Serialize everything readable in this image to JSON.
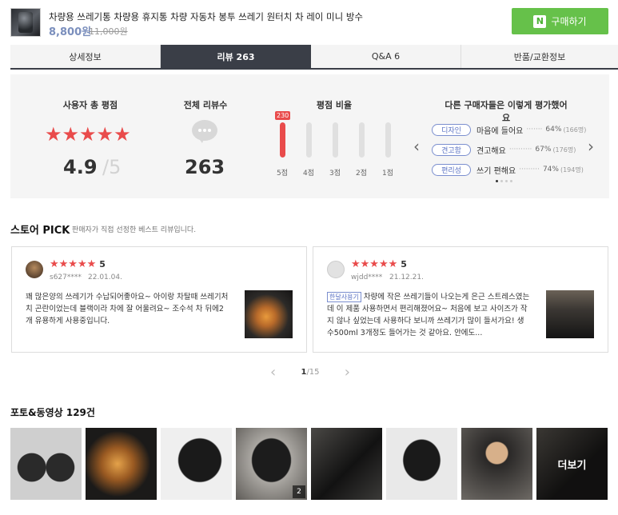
{
  "product": {
    "title": "차량용 쓰레기통 차량용 휴지통 차량 자동차 봉투 쓰레기 원터치 차 레이 미니 방수",
    "price": "8,800원",
    "original_price": "11,000원",
    "buy_logo": "N",
    "buy_label": "구매하기"
  },
  "tabs": [
    "상세정보",
    "리뷰 263",
    "Q&A 6",
    "반품/교환정보"
  ],
  "summary": {
    "avg_label": "사용자 총 평점",
    "stars": "★★★★★",
    "avg_value": "4.9",
    "avg_max": "/5",
    "count_label": "전체 리뷰수",
    "count_value": "263",
    "ratio_label": "평점 비율",
    "ratio": [
      {
        "label": "5점",
        "fraction": 1.0,
        "badge": "230"
      },
      {
        "label": "4점",
        "fraction": 0.0,
        "badge": ""
      },
      {
        "label": "3점",
        "fraction": 0.0,
        "badge": ""
      },
      {
        "label": "2점",
        "fraction": 0.0,
        "badge": ""
      },
      {
        "label": "1점",
        "fraction": 0.0,
        "badge": ""
      }
    ],
    "others_label": "다른 구매자들은 이렇게 평가했어요",
    "others": [
      {
        "tag": "디자인",
        "text": "마음에 들어요",
        "pct": "64%",
        "count": "(166명)"
      },
      {
        "tag": "견고함",
        "text": "견고해요",
        "pct": "67%",
        "count": "(176명)"
      },
      {
        "tag": "편리성",
        "text": "쓰기 편해요",
        "pct": "74%",
        "count": "(194명)"
      }
    ],
    "prev_arrow": "‹",
    "next_arrow": "›"
  },
  "pick": {
    "title": "스토어 PICK",
    "subtitle": "판매자가 직접 선정한 베스트 리뷰입니다.",
    "reviews": [
      {
        "stars": "★★★★★",
        "score": "5",
        "user": "s627****",
        "date": "22.01.04.",
        "option": "",
        "text": "꽤 많은양의 쓰레기가 수납되어좋아요~ 아이랑 차탈때 쓰레기처치 곤란이었는데 블랙이라 차에 잘 어울려요~ 조수석 차 뒤에2개 유용하게 사용중입니다."
      },
      {
        "stars": "★★★★★",
        "score": "5",
        "user": "wjdd****",
        "date": "21.12.21.",
        "option": "한달사용기",
        "text": "차량에 작은 쓰레기들이 나오는게 은근 스트레스였는데 이 제품 사용하면서 편리해졌어요~ 처음에 보고 사이즈가 작지 않나 싶었는데 사용하다 보니까 쓰레기가 많이 들서가요! 생수500ml 3개정도 들어가는 것 같아요. 안에도..."
      }
    ],
    "page_current": "1",
    "page_total": "/15",
    "prev": "‹",
    "next": "›"
  },
  "photos": {
    "title": "포토&동영상 129건",
    "badge": "2",
    "more": "더보기"
  },
  "colors": {
    "accent_red": "#e94b4b",
    "tab_active": "#3a3e47",
    "buy_green": "#66c14a",
    "tag_blue": "#5a72c4"
  }
}
